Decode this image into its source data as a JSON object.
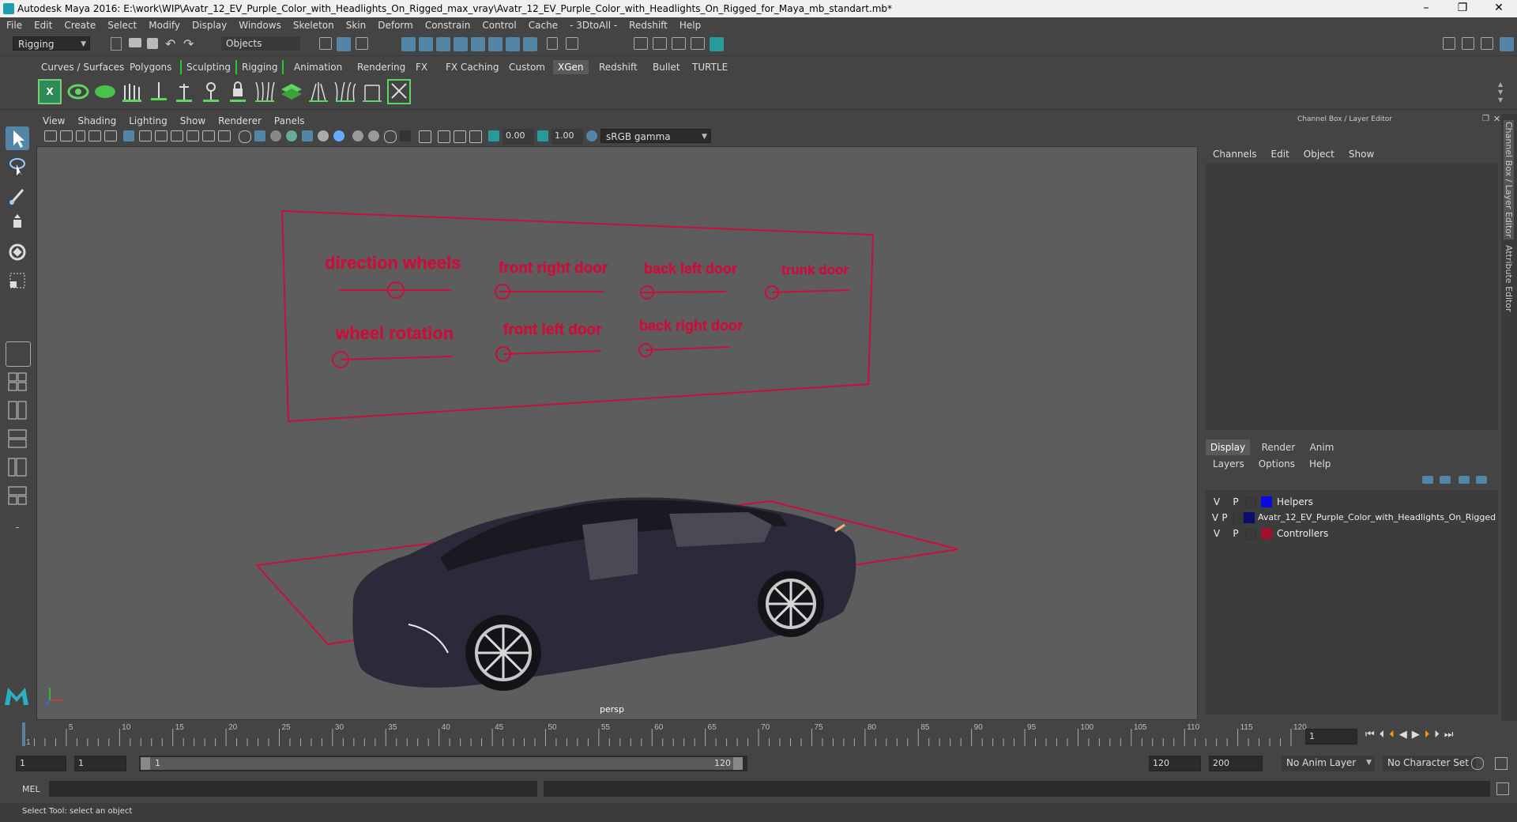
{
  "window": {
    "title": "Autodesk Maya 2016: E:\\work\\WIP\\Avatr_12_EV_Purple_Color_with_Headlights_On_Rigged_max_vray\\Avatr_12_EV_Purple_Color_with_Headlights_On_Rigged_for_Maya_mb_standart.mb*",
    "minimize": "–",
    "restore": "❐",
    "close": "✕"
  },
  "menubar": [
    "File",
    "Edit",
    "Create",
    "Select",
    "Modify",
    "Display",
    "Windows",
    "Skeleton",
    "Skin",
    "Deform",
    "Constrain",
    "Control",
    "Cache",
    "- 3DtoAll -",
    "Redshift",
    "Help"
  ],
  "status": {
    "menuset": "Rigging",
    "selection_mode": "Objects",
    "snap_value": ""
  },
  "shelf_tabs": [
    "Curves / Surfaces",
    "Polygons",
    "Sculpting",
    "Rigging",
    "Animation",
    "Rendering",
    "FX",
    "FX Caching",
    "Custom",
    "XGen",
    "Redshift",
    "Bullet",
    "TURTLE"
  ],
  "active_shelf_tab": "XGen",
  "panel_menu": [
    "View",
    "Shading",
    "Lighting",
    "Show",
    "Renderer",
    "Panels"
  ],
  "panel_toolbar": {
    "exposure": "0.00",
    "gamma": "1.00",
    "color_space": "sRGB gamma"
  },
  "viewport": {
    "camera_label": "persp",
    "controls_labels": [
      "direction wheels",
      "front right door",
      "back left door",
      "trunk door",
      "wheel rotation",
      "front left door",
      "back right door"
    ]
  },
  "channel_box": {
    "title": "Channel Box / Layer Editor",
    "menu": [
      "Channels",
      "Edit",
      "Object",
      "Show"
    ],
    "side_tabs": [
      "Channel Box / Layer Editor",
      "Attribute Editor"
    ]
  },
  "layer_editor": {
    "tabs": [
      "Display",
      "Render",
      "Anim"
    ],
    "active_tab": "Display",
    "menu": [
      "Layers",
      "Options",
      "Help"
    ],
    "layers": [
      {
        "v": "V",
        "p": "P",
        "name": "Helpers",
        "color": "#0a0adc"
      },
      {
        "v": "V",
        "p": "P",
        "name": "Avatr_12_EV_Purple_Color_with_Headlights_On_Rigged",
        "color": "#0c0c6a"
      },
      {
        "v": "V",
        "p": "P",
        "name": "Controllers",
        "color": "#a0102c"
      }
    ]
  },
  "timeline": {
    "ticks": [
      "1",
      "5",
      "10",
      "15",
      "20",
      "25",
      "30",
      "35",
      "40",
      "45",
      "50",
      "55",
      "60",
      "65",
      "70",
      "75",
      "80",
      "85",
      "90",
      "95",
      "100",
      "105",
      "110",
      "115",
      "120"
    ],
    "current_frame": "1"
  },
  "range": {
    "start": "1",
    "playback_start": "1",
    "slider_start": "1",
    "slider_end": "120",
    "playback_end": "120",
    "end": "200",
    "anim_layer": "No Anim Layer",
    "character_set": "No Character Set"
  },
  "cmdline": {
    "label": "MEL"
  },
  "helpline": {
    "text": "Select Tool: select an object"
  },
  "colors": {
    "control_red": "#c8103c",
    "accent": "#5285a6"
  }
}
